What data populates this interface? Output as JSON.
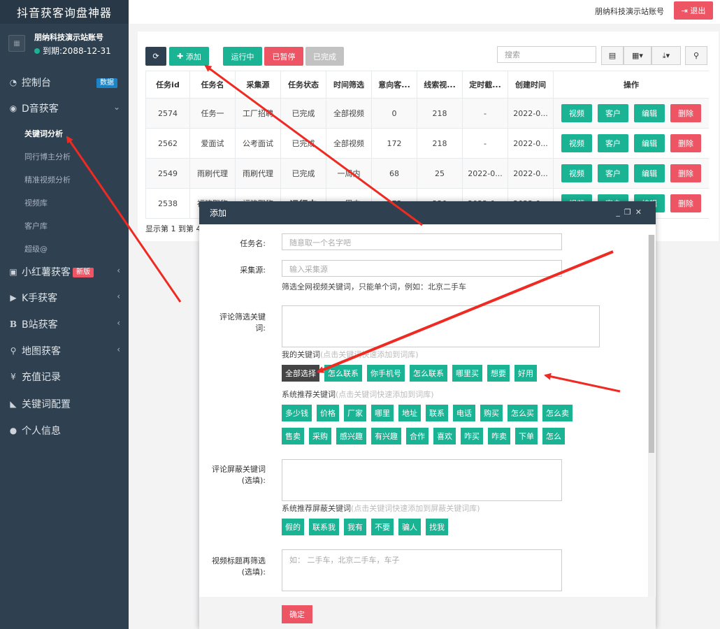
{
  "app_title": "抖音获客询盘神器",
  "profile": {
    "name": "朋纳科技演示站账号",
    "expiry": "到期:2088-12-31"
  },
  "nav": {
    "dashboard": {
      "label": "控制台",
      "badge": "数据"
    },
    "douyin": {
      "label": "D音获客"
    },
    "douyin_sub": [
      "关键词分析",
      "同行博主分析",
      "精准视频分析",
      "视频库",
      "客户库",
      "超级@"
    ],
    "xhs": {
      "label": "小红薯获客",
      "badge": "新版"
    },
    "kuaishou": {
      "label": "K手获客"
    },
    "bilibili": {
      "label": "B站获客"
    },
    "map": {
      "label": "地图获客"
    },
    "recharge": {
      "label": "充值记录"
    },
    "keyword_config": {
      "label": "关键词配置"
    },
    "personal": {
      "label": "个人信息"
    }
  },
  "topbar": {
    "account": "朋纳科技演示站账号",
    "logout": "退出"
  },
  "toolbar": {
    "refresh": "⟳",
    "add": "添加",
    "running": "运行中",
    "paused": "已暂停",
    "done": "已完成",
    "search_placeholder": "搜索"
  },
  "table": {
    "headers": [
      "任务id",
      "任务名",
      "采集源",
      "任务状态",
      "时间筛选",
      "意向客...",
      "线索视...",
      "定时截...",
      "创建时间",
      "操作"
    ],
    "rows": [
      {
        "id": "2574",
        "name": "任务一",
        "source": "工厂招聘",
        "status": "已完成",
        "time": "全部视频",
        "intent": "0",
        "leads": "218",
        "sched": "-",
        "created": "2022-0..."
      },
      {
        "id": "2562",
        "name": "爱面试",
        "source": "公考面试",
        "status": "已完成",
        "time": "全部视频",
        "intent": "172",
        "leads": "218",
        "sched": "-",
        "created": "2022-0..."
      },
      {
        "id": "2549",
        "name": "雨刷代理",
        "source": "雨刷代理",
        "status": "已完成",
        "time": "一周内",
        "intent": "68",
        "leads": "25",
        "sched": "2022-0...",
        "created": "2022-0..."
      },
      {
        "id": "2538",
        "name": "福建职称",
        "source": "福建职称",
        "status": "运行中",
        "time": "一周内",
        "intent": "173",
        "leads": "220",
        "sched": "2022-0...",
        "created": "2022-0..."
      }
    ],
    "actions": [
      "视频",
      "客户",
      "编辑",
      "删除"
    ],
    "pager": "显示第 1 到第 4"
  },
  "modal": {
    "title": "添加",
    "task_name": {
      "label": "任务名:",
      "placeholder": "随意取一个名字吧"
    },
    "source": {
      "label": "采集源:",
      "placeholder": "输入采集源",
      "hint": "筛选全网视频关键词，只能单个词，例如：北京二手车"
    },
    "comment_filter": {
      "label_1": "评论筛选关键",
      "label_2": "词:"
    },
    "my_keywords": {
      "title": "我的关键词",
      "hint": "(点击关键词快速添加到词库)",
      "tags": [
        "全部选择",
        "怎么联系",
        "你手机号",
        "怎么联系",
        "哪里买",
        "想要",
        "好用"
      ]
    },
    "sys_keywords": {
      "title": "系统推荐关键词",
      "hint": "(点击关键词快速添加到词库)",
      "row1": [
        "多少钱",
        "价格",
        "厂家",
        "哪里",
        "地址",
        "联系",
        "电话",
        "购买",
        "怎么买",
        "怎么卖"
      ],
      "row2": [
        "售卖",
        "采购",
        "感兴趣",
        "有兴趣",
        "合作",
        "喜欢",
        "咋买",
        "咋卖",
        "下单",
        "怎么"
      ]
    },
    "block_keywords": {
      "label_1": "评论屏蔽关键词",
      "label_2": "(选填):"
    },
    "sys_block": {
      "title": "系统推荐屏蔽关键词",
      "hint": "(点击关键词快速添加到屏蔽关键词库)",
      "tags": [
        "假的",
        "联系我",
        "我有",
        "不要",
        "骗人",
        "找我"
      ]
    },
    "title_filter": {
      "label_1": "视频标题再筛选",
      "label_2": "(选填):",
      "placeholder": "如： 二手车，北京二手车，车子"
    },
    "confirm": "确定"
  }
}
